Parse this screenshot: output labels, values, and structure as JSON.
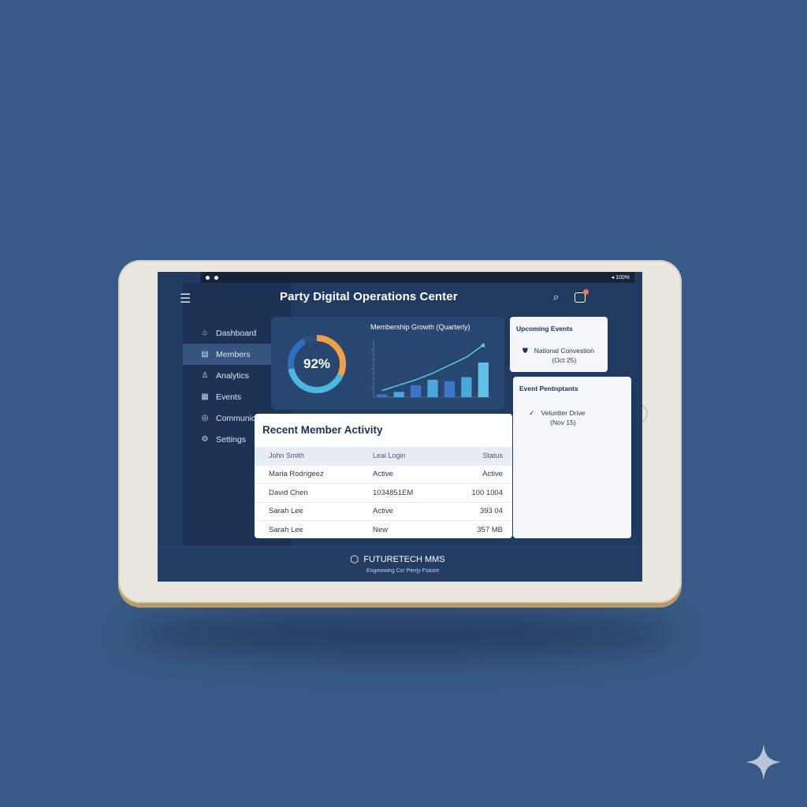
{
  "app": {
    "title": "Party Digital Operations Center"
  },
  "statusbar": {
    "right": "◂ 100%"
  },
  "sidebar": {
    "items": [
      {
        "label": "Dashboard",
        "icon": "dashboard-icon",
        "active": false
      },
      {
        "label": "Members",
        "icon": "members-icon",
        "active": true
      },
      {
        "label": "Analytics",
        "icon": "analytics-icon",
        "active": false
      },
      {
        "label": "Events",
        "icon": "events-icon",
        "active": false
      },
      {
        "label": "Communications",
        "icon": "communications-icon",
        "active": false
      },
      {
        "label": "Settings",
        "icon": "settings-icon",
        "active": false
      }
    ]
  },
  "gauge": {
    "value": "92%",
    "fraction": 0.92,
    "colors": [
      "#f0a04b",
      "#4fb6e0",
      "#2f6fbf"
    ]
  },
  "chart_data": {
    "type": "bar",
    "title": "Membership Growth (Quarterly)",
    "categories": [
      "",
      "",
      "",
      "",
      "",
      "",
      ""
    ],
    "values": [
      4,
      8,
      18,
      26,
      24,
      30,
      52
    ],
    "trend": [
      10,
      18,
      26,
      36,
      48,
      60,
      78
    ],
    "ylim": [
      0,
      85
    ]
  },
  "upcoming": {
    "heading": "Upcoming Events",
    "name": "National Convestion",
    "date": "(Oct 25)"
  },
  "participants": {
    "heading": "Event Pentnptants",
    "name": "Veluntter Drive",
    "date": "(Nov 15)"
  },
  "activity": {
    "heading": "Recent Member Activity",
    "columns": [
      "John Smith",
      "Leal Login",
      "Status"
    ],
    "rows": [
      [
        "Maria Rodrigeez",
        "Active",
        "Active"
      ],
      [
        "David Chen",
        "1034851EM",
        "100 1004"
      ],
      [
        "Sarah Lee",
        "Active",
        "393 04"
      ],
      [
        "Sarah Lee",
        "New",
        "357 MB"
      ]
    ]
  },
  "footer": {
    "brand": "FUTURETECH MMS",
    "tagline": "Engewwing Ccr Perrjy Fsasre"
  }
}
